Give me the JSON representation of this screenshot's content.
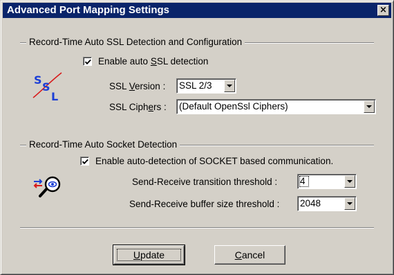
{
  "window": {
    "title": "Advanced Port Mapping Settings",
    "close_glyph": "×"
  },
  "ssl_group": {
    "title": "Record-Time Auto SSL Detection and Configuration",
    "enable_checkbox": {
      "checked": true,
      "label_pre": "Enable auto ",
      "label_mnemonic": "S",
      "label_post": "SL detection"
    },
    "icon": "ssl-icon",
    "version": {
      "label_pre": "SSL ",
      "label_mnemonic": "V",
      "label_post": "ersion :",
      "value": "SSL 2/3"
    },
    "ciphers": {
      "label_pre": "SSL Ciph",
      "label_mnemonic": "e",
      "label_post": "rs :",
      "value": "(Default OpenSsl Ciphers)"
    }
  },
  "socket_group": {
    "title": "Record-Time Auto Socket Detection",
    "enable_checkbox": {
      "checked": true,
      "label": "Enable auto-detection of SOCKET based communication."
    },
    "icon": "socket-detection-icon",
    "transition": {
      "label": "Send-Receive transition threshold :",
      "value": "4"
    },
    "buffer": {
      "label": "Send-Receive buffer size threshold :",
      "value": "2048"
    }
  },
  "buttons": {
    "update": {
      "mnemonic": "U",
      "rest": "pdate"
    },
    "cancel": {
      "mnemonic": "C",
      "rest": "ancel"
    }
  },
  "colors": {
    "title_bar": "#0a246a",
    "face": "#d4d0c8",
    "icon_blue": "#1c3fd6",
    "icon_red": "#d81a1a"
  }
}
